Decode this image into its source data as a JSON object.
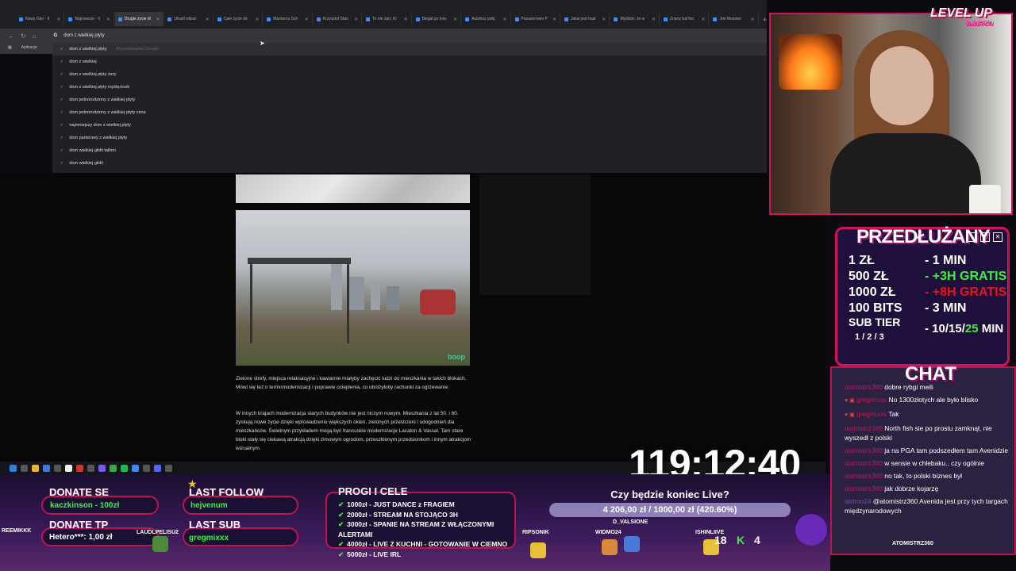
{
  "browser": {
    "tabs": [
      "Nowy Gier - Il",
      "Najnowsze - Il",
      "Drugie życie dl",
      "Utradl wlizać",
      "Całe życie de",
      "Marianna Sch",
      "Krzysztof Stan",
      "To nie żart, Ki",
      "Biegał po tran",
      "Autobus połq",
      "Pasażerowie P",
      "Jakie jest hasł",
      "Myślicie, że w",
      "Znany bał foo",
      "Joe Monster"
    ],
    "active_tab": 2,
    "new_tab": "+",
    "omnibox_text": "dom z wielkiej płyty",
    "bookmarks_label": "Aplikacje",
    "suggestions": [
      {
        "text": "dom z wielkiej płyty",
        "tail": "- Wyszukiwarka Google"
      },
      {
        "text": "dom z wielkiej",
        "tail": ""
      },
      {
        "text": "dom z wielkiej płyty żery",
        "tail": ""
      },
      {
        "text": "dom z wielkiej płyty myślęcinek",
        "tail": ""
      },
      {
        "text": "dom jednorodzinny z wielkiej płyty",
        "tail": ""
      },
      {
        "text": "dom jednorodzinny z wielkiej płyty cena",
        "tail": ""
      },
      {
        "text": "najmniejszy dom z wielkiej płyty",
        "tail": ""
      },
      {
        "text": "dom parterowy z wielkiej płyty",
        "tail": ""
      },
      {
        "text": "dom wielkiej gildii tallinn",
        "tail": ""
      },
      {
        "text": "dom wielkiej gildii",
        "tail": ""
      }
    ]
  },
  "article": {
    "image_logo": "boop",
    "paragraph1": "Zielone strefy, miejsca relaksacyjne i kawiarnie miałyby zachęcić ludzi do mieszkania w takich blokach. Mówi się też o termomodernizacji i poprawie ocieplenia, co obniżyłoby rachunki za ogrzewanie.",
    "paragraph2": "W innych krajach modernizacja starych budynków nie jest niczym nowym. Mieszkania z lat 50. i 60. zyskują nowe życie dzięki wprowadzeniu większych okien, zielonych przestrzeni i udogodnień dla mieszkańców. Świetnym przykładem mogą być francuskie modernizacje Lacaton & Vassal. Tam stare bloki stały się ciekawą atrakcją dzięki zimowym ogrodom, przeszklonym przedsionkom i innym atrakcjom wizualnym."
  },
  "overlay": {
    "level_up": "LEVEL UP",
    "level_up_sub": "JuJuRiCki",
    "timer": "119:12:40",
    "extended": {
      "title": "PRZEDŁUŻANY",
      "rates": [
        {
          "amount": "1 ZŁ",
          "time": "- 1 MIN",
          "style": ""
        },
        {
          "amount": "500 ZŁ",
          "time": "- +3H GRATIS",
          "style": "g"
        },
        {
          "amount": "1000 ZŁ",
          "time": "- +8H GRATIS",
          "style": "red"
        },
        {
          "amount": "100 BITS",
          "time": "- 3 MIN",
          "style": ""
        }
      ],
      "sub_label": "SUB TIER",
      "sub_tiers": "1 / 2 / 3",
      "sub_time_a": "- 10/15/",
      "sub_time_b": "25",
      "sub_time_c": " MIN"
    },
    "chat": {
      "title": "CHAT",
      "messages": [
        {
          "user": "atomistrz360",
          "text": "dobre rybgi meili",
          "icons": ""
        },
        {
          "user": "gregmixxx",
          "text": "No 1300złotych ale było blisko",
          "icons": "♥ ▣"
        },
        {
          "user": "gregmixxx",
          "text": "Tak",
          "icons": "♥ ▣"
        },
        {
          "user": "atomistrz360",
          "text": "North fish sie po prostu zamknął, nie wyszedł z polski",
          "icons": ""
        },
        {
          "user": "atomistrz360",
          "text": "ja na PGA tam podszedłem tam Avenidzie",
          "icons": ""
        },
        {
          "user": "atomistrz360",
          "text": "w sensie w chlebaku.. czy ogólnie",
          "icons": ""
        },
        {
          "user": "atomistrz360",
          "text": "no tak, to polski biznes był",
          "icons": ""
        },
        {
          "user": "atomistrz360",
          "text": "jak dobrze kojarzę",
          "icons": ""
        },
        {
          "user": "widmo24",
          "text": "@atomistrz360 Avenida jest przy tych targach międzynarodowych",
          "icons": ""
        }
      ]
    },
    "donate_se_label": "DONATE SE",
    "donate_se_value": "kaczkinson - 100zł",
    "donate_tp_label": "DONATE TP",
    "donate_tp_value": "Hetero***: 1,00 zł",
    "last_follow_label": "LAST FOLLOW",
    "last_follow_value": "hejvenum",
    "last_sub_label": "LAST SUB",
    "last_sub_value": "gregmixxx",
    "goals": {
      "title": "PROGI I CELE",
      "items": [
        "1000zł - JUST DANCE z FRAGIEM",
        "2000zł - STREAM NA STOJĄCO 3H",
        "3000zł - SPANIE NA STREAM Z WŁĄCZONYMI ALERTAMI",
        "4000zł - LIVE Z KUCHNI - GOTOWANIE W CIEMNO",
        "5000zł - LIVE IRL"
      ]
    },
    "live_question": "Czy będzie koniec Live?",
    "live_progress": "4 206,00 zł / 1000,00 zł (420.60%)",
    "live_progress_fraction": 1.0,
    "viewer_names": [
      "REEMIKKK",
      "LAUDLPELISU2",
      "RIPSONIK",
      "WIDMO24",
      "D_VALSIONE",
      "ISHINLIIVE",
      "ATOMISTRZ360"
    ],
    "score_a": "18",
    "score_k": "K",
    "score_b": "4"
  }
}
